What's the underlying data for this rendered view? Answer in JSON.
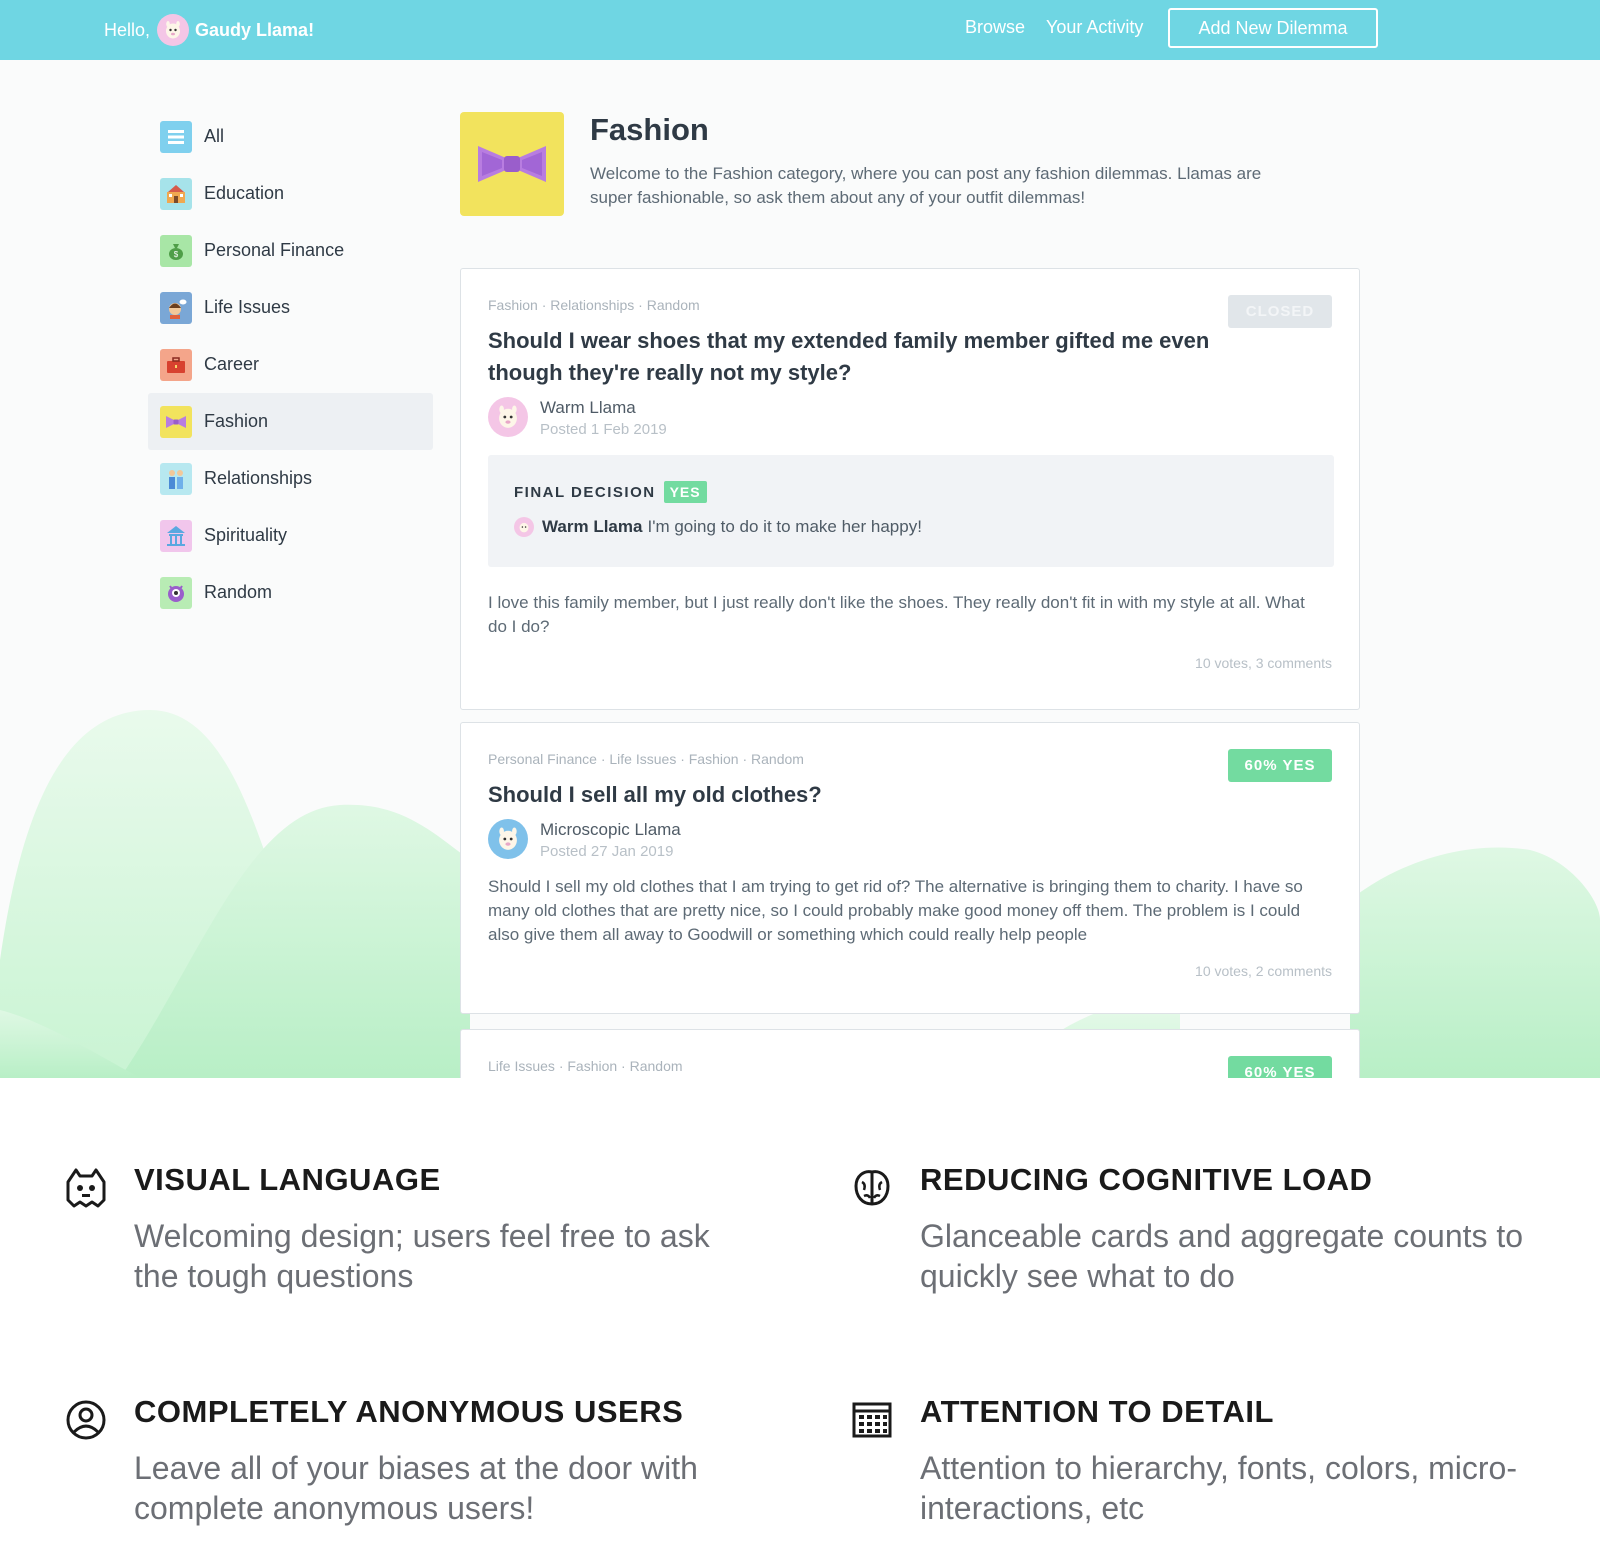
{
  "topbar": {
    "hello": "Hello,",
    "user_name": "Gaudy Llama!",
    "browse": "Browse",
    "activity": "Your Activity",
    "add_button": "Add New Dilemma"
  },
  "sidebar": {
    "items": [
      {
        "label": "All",
        "icon": "list-icon",
        "color": "#7fd0ee"
      },
      {
        "label": "Education",
        "icon": "school-icon",
        "color": "#a6e3ea"
      },
      {
        "label": "Personal Finance",
        "icon": "money-bag-icon",
        "color": "#a8e6a6"
      },
      {
        "label": "Life Issues",
        "icon": "thinking-person-icon",
        "color": "#7aa7d6"
      },
      {
        "label": "Career",
        "icon": "briefcase-icon",
        "color": "#f4a58a"
      },
      {
        "label": "Fashion",
        "icon": "bow-tie-icon",
        "color": "#f2e35d"
      },
      {
        "label": "Relationships",
        "icon": "couple-icon",
        "color": "#b7e8f0"
      },
      {
        "label": "Spirituality",
        "icon": "temple-icon",
        "color": "#f1c6ec"
      },
      {
        "label": "Random",
        "icon": "monster-icon",
        "color": "#b8ecb4"
      }
    ],
    "active": "Fashion"
  },
  "category": {
    "title": "Fashion",
    "description": "Welcome to the Fashion category, where you can post any fashion dilemmas. Llamas are super fashionable, so ask them about any of your outfit dilemmas!"
  },
  "posts": [
    {
      "tags": "Fashion · Relationships · Random",
      "status": "CLOSED",
      "title": "Should I wear shoes that my extended family member gifted me even though they're really not my style?",
      "author": "Warm Llama",
      "date": "Posted 1 Feb 2019",
      "decision_label": "FINAL DECISION",
      "decision_value": "YES",
      "decision_author": "Warm Llama",
      "decision_text": "I'm going to do it to make her happy!",
      "body": "I love this family member, but I just really don't like the shoes. They really don't fit in with my style at all. What do I do?",
      "counts": "10 votes, 3 comments"
    },
    {
      "tags": "Personal Finance · Life Issues · Fashion · Random",
      "status": "60% YES",
      "title": "Should I sell all my old clothes?",
      "author": "Microscopic Llama",
      "date": "Posted 27 Jan 2019",
      "body": "Should I sell my old clothes that I am trying to get rid of? The alternative is bringing them to charity. I have so many old clothes that are pretty nice, so I could probably make good money off them. The problem is I could also give them all away to Goodwill or something which could really help people",
      "counts": "10 votes, 2 comments"
    },
    {
      "tags": "Life Issues · Fashion · Random",
      "status": "60% YES"
    }
  ],
  "features": [
    {
      "icon": "monster-outline-icon",
      "title": "VISUAL LANGUAGE",
      "text": "Welcoming design; users feel free to ask the tough questions"
    },
    {
      "icon": "brain-icon",
      "title": "REDUCING COGNITIVE LOAD",
      "text": "Glanceable cards and aggregate counts to quickly see what to do"
    },
    {
      "icon": "anonymous-user-icon",
      "title": "COMPLETELY ANONYMOUS USERS",
      "text": "Leave all of your biases at the door with complete anonymous users!"
    },
    {
      "icon": "grid-detail-icon",
      "title": "ATTENTION TO DETAIL",
      "text": "Attention to hierarchy, fonts, colors, micro-interactions, etc"
    }
  ],
  "colors": {
    "topbar": "#6fd6e3",
    "yes_green": "#73dba0",
    "hill_green": "#c8f5d2"
  }
}
